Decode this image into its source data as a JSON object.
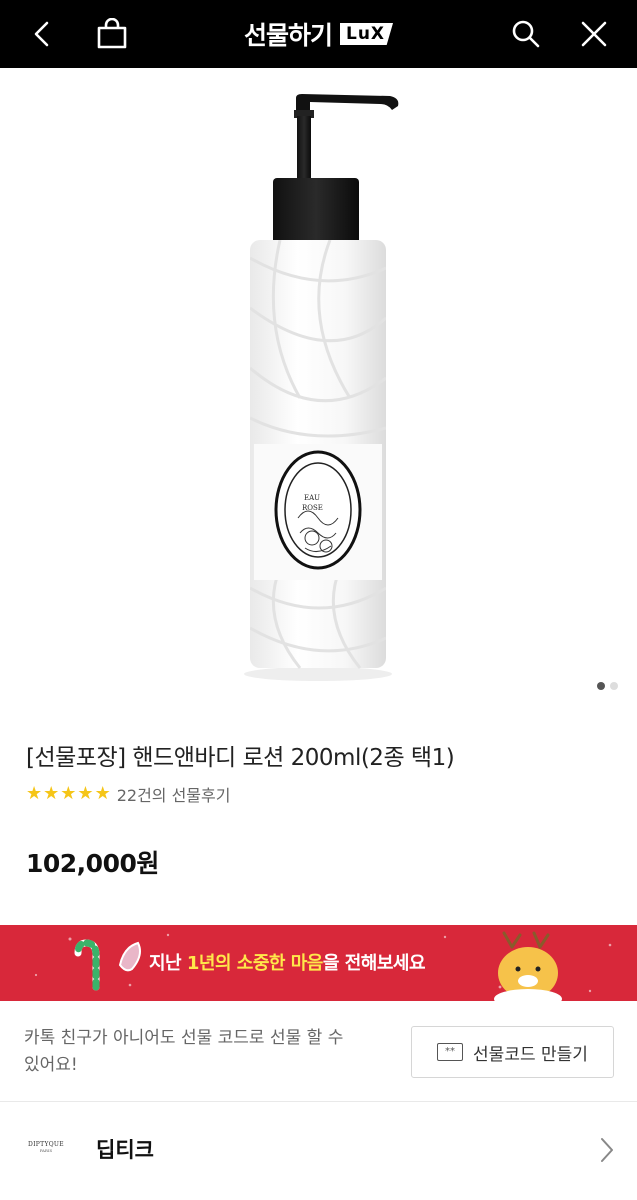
{
  "header": {
    "title": "선물하기",
    "badge": "LuX",
    "icons": [
      "back-arrow-icon",
      "shopping-bag-icon",
      "search-icon",
      "close-icon"
    ]
  },
  "gallery": {
    "image": "diptyque-hand-body-lotion-bottle",
    "total_slides": 2,
    "active_slide": 1,
    "label_lines": [
      "EAU",
      "ROSE"
    ]
  },
  "product": {
    "title": "[선물포장] 핸드앤바디 로션 200ml(2종 택1)",
    "rating_stars": 5,
    "review_text": "22건의 선물후기",
    "price": "102,000원"
  },
  "banner": {
    "text_prefix": "지난 ",
    "text_highlight": "1년의 소중한 마음",
    "text_suffix": "을 전해보세요",
    "bg_color": "#d8283a",
    "highlight_color": "#ffe84a"
  },
  "giftcode": {
    "description": "카톡 친구가 아니어도 선물 코드로 선물 할 수 있어요!",
    "icon_text": "**",
    "button_label": "선물코드 만들기"
  },
  "brand": {
    "logo_line1": "DIPTYQUE",
    "logo_line2": "PARIS",
    "name": "딥티크"
  }
}
